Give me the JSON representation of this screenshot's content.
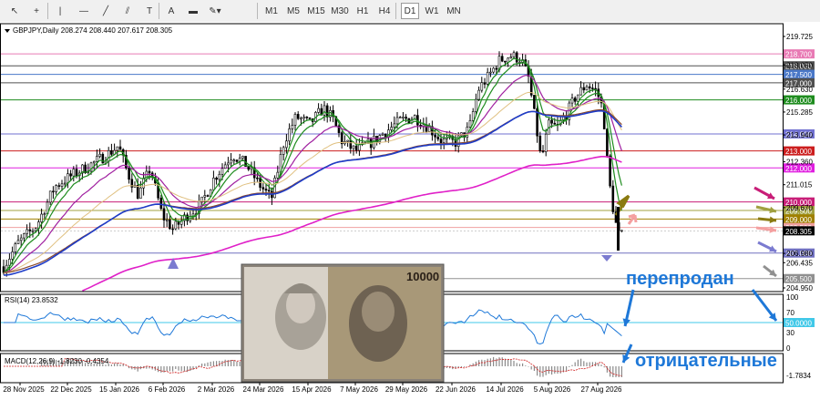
{
  "toolbar": {
    "tools": [
      {
        "name": "cursor-tool-icon",
        "symbol": "↖"
      },
      {
        "name": "crosshair-tool-icon",
        "symbol": "+"
      },
      {
        "name": "vertical-line-tool-icon",
        "symbol": "|"
      },
      {
        "name": "horizontal-line-tool-icon",
        "symbol": "—"
      },
      {
        "name": "trendline-tool-icon",
        "symbol": "╱"
      },
      {
        "name": "channel-tool-icon",
        "symbol": "⫽"
      },
      {
        "name": "text-tool-icon",
        "symbol": "T"
      },
      {
        "name": "text-label-tool-icon",
        "symbol": "A"
      },
      {
        "name": "rectangle-tool-icon",
        "symbol": "▬"
      },
      {
        "name": "shapes-tool-icon",
        "symbol": "✎▾"
      }
    ],
    "timeframes": [
      "M1",
      "M5",
      "M15",
      "M30",
      "H1",
      "H4",
      "D1",
      "W1",
      "MN"
    ],
    "active_timeframe": "D1"
  },
  "chart_header": {
    "symbol": "GBPJPY,Daily",
    "ohlc": "208.274 208.440 207.617 208.305"
  },
  "price_axis": {
    "ticks": [
      "219.725",
      "218.050",
      "216.630",
      "215.285",
      "213.940",
      "212.360",
      "211.015",
      "209.670",
      "208.325",
      "206.980",
      "206.435",
      "204.950"
    ],
    "levels": [
      {
        "price": 218.7,
        "label": "218.700",
        "color": "#e87ab4"
      },
      {
        "price": 218.0,
        "label": "218.000",
        "color": "#505050"
      },
      {
        "price": 217.5,
        "label": "217.500",
        "color": "#4a78c8"
      },
      {
        "price": 217.0,
        "label": "217.000",
        "color": "#505050"
      },
      {
        "price": 216.0,
        "label": "216.000",
        "color": "#1e8c1e"
      },
      {
        "price": 214.0,
        "label": "214.000",
        "color": "#7070d0"
      },
      {
        "price": 213.0,
        "label": "213.000",
        "color": "#cc1e1e"
      },
      {
        "price": 212.0,
        "label": "212.000",
        "color": "#e01ee0"
      },
      {
        "price": 210.0,
        "label": "210.000",
        "color": "#c81e78"
      },
      {
        "price": 209.5,
        "label": "209.500",
        "color": "#a0a040"
      },
      {
        "price": 209.0,
        "label": "209.000",
        "color": "#a08000"
      },
      {
        "price": 208.5,
        "label": "208.500",
        "color": "#f0a0a0"
      },
      {
        "price": 207.0,
        "label": "207.000",
        "color": "#7070c0"
      },
      {
        "price": 205.5,
        "label": "205.500",
        "color": "#909090"
      }
    ],
    "current": "208.305"
  },
  "rsi": {
    "label": "RSI(14) 23.8532",
    "ticks": [
      "100",
      "70",
      "50",
      "30",
      "0"
    ],
    "level_label": "50.0000"
  },
  "macd": {
    "label": "MACD(12,26,9) -1.8230 -0.4354",
    "ticks": [
      "-1.7834"
    ]
  },
  "date_axis": [
    "28 Nov 2025",
    "22 Dec 2025",
    "15 Jan 2026",
    "6 Feb 2026",
    "2 Mar 2026",
    "24 Mar 2026",
    "15 Apr 2026",
    "7 May 2026",
    "29 May 2026",
    "22 Jun 2026",
    "14 Jul 2026",
    "5 Aug 2026",
    "27 Aug 2026"
  ],
  "annotations": {
    "oversold_text": "перепродан",
    "negative_text": "отрицательные",
    "photo_note": "10000"
  },
  "colors": {
    "ema_fast": "#1e8c1e",
    "ema_slow": "#a020a0",
    "ma_tan": "#e0c080",
    "ma_blue": "#1e3cc8",
    "ma_brown": "#8b4a2b",
    "ma_magenta": "#e020c8",
    "arrow_blue": "#1e78d8"
  }
}
